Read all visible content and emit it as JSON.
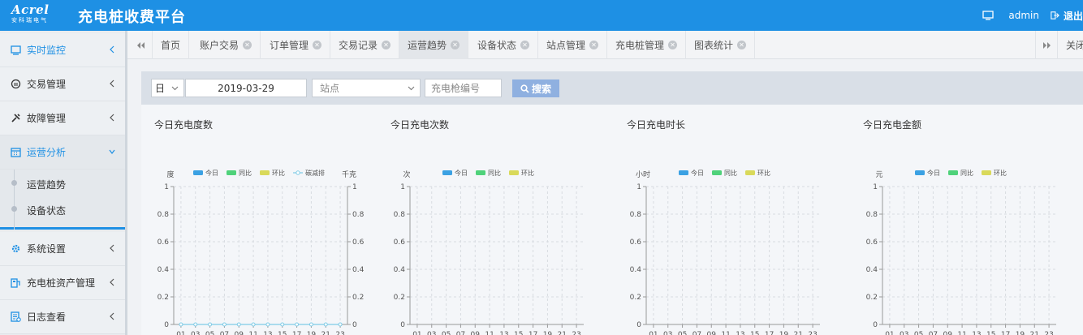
{
  "header": {
    "logo_text": "Acrel",
    "logo_sub": "安科瑞电气",
    "app_title": "充电桩收费平台",
    "user": "admin",
    "logout_label": "退出"
  },
  "sidebar": {
    "items": [
      {
        "label": "实时监控",
        "icon": "monitor-icon",
        "active": true
      },
      {
        "label": "交易管理",
        "icon": "transaction-icon"
      },
      {
        "label": "故障管理",
        "icon": "wrench-icon"
      },
      {
        "label": "运营分析",
        "icon": "calendar-icon",
        "active": true,
        "expanded": true
      },
      {
        "label": "系统设置",
        "icon": "gear-icon"
      },
      {
        "label": "充电桩资产管理",
        "icon": "asset-icon"
      },
      {
        "label": "日志查看",
        "icon": "log-icon"
      }
    ],
    "subitems": [
      "运营趋势",
      "设备状态"
    ]
  },
  "tabs": {
    "items": [
      "首页",
      "账户交易",
      "订单管理",
      "交易记录",
      "运营趋势",
      "设备状态",
      "站点管理",
      "充电桩管理",
      "图表统计"
    ],
    "active_index": 4,
    "close_label": "关闭操作"
  },
  "filter": {
    "period": "日",
    "date": "2019-03-29",
    "station_placeholder": "站点",
    "gun_placeholder": "充电枪编号",
    "search_label": "搜索"
  },
  "colors": {
    "accent": "#1e90e4",
    "today": "#3ba1e3",
    "yoy": "#4fd27a",
    "mom": "#d9d95a",
    "carbon": "#7ecbe6"
  },
  "chart_data": [
    {
      "type": "line",
      "title": "今日充电度数",
      "ylabel": "度",
      "y2label": "千克",
      "legend": [
        "今日",
        "同比",
        "环比",
        "碳减排"
      ],
      "x": [
        "01",
        "03",
        "05",
        "07",
        "09",
        "11",
        "13",
        "15",
        "17",
        "19",
        "21",
        "23"
      ],
      "ylim": [
        0,
        1
      ],
      "yticks": [
        "0",
        "0.2",
        "0.4",
        "0.6",
        "0.8",
        "1"
      ],
      "series": [
        {
          "name": "碳减排",
          "values": [
            0,
            0,
            0,
            0,
            0,
            0,
            0,
            0,
            0,
            0,
            0,
            0
          ]
        }
      ]
    },
    {
      "type": "line",
      "title": "今日充电次数",
      "ylabel": "次",
      "legend": [
        "今日",
        "同比",
        "环比"
      ],
      "x": [
        "01",
        "03",
        "05",
        "07",
        "09",
        "11",
        "13",
        "15",
        "17",
        "19",
        "21",
        "23"
      ],
      "ylim": [
        0,
        1
      ],
      "yticks": [
        "0",
        "0.2",
        "0.4",
        "0.6",
        "0.8",
        "1"
      ],
      "series": []
    },
    {
      "type": "line",
      "title": "今日充电时长",
      "ylabel": "小时",
      "legend": [
        "今日",
        "同比",
        "环比"
      ],
      "x": [
        "01",
        "03",
        "05",
        "07",
        "09",
        "11",
        "13",
        "15",
        "17",
        "19",
        "21",
        "23"
      ],
      "ylim": [
        0,
        1
      ],
      "yticks": [
        "0",
        "0.2",
        "0.4",
        "0.6",
        "0.8",
        "1"
      ],
      "series": []
    },
    {
      "type": "line",
      "title": "今日充电金额",
      "ylabel": "元",
      "legend": [
        "今日",
        "同比",
        "环比"
      ],
      "x": [
        "01",
        "03",
        "05",
        "07",
        "09",
        "11",
        "13",
        "15",
        "17",
        "19",
        "21",
        "23"
      ],
      "ylim": [
        0,
        1
      ],
      "yticks": [
        "0",
        "0.2",
        "0.4",
        "0.6",
        "0.8",
        "1"
      ],
      "series": []
    }
  ]
}
